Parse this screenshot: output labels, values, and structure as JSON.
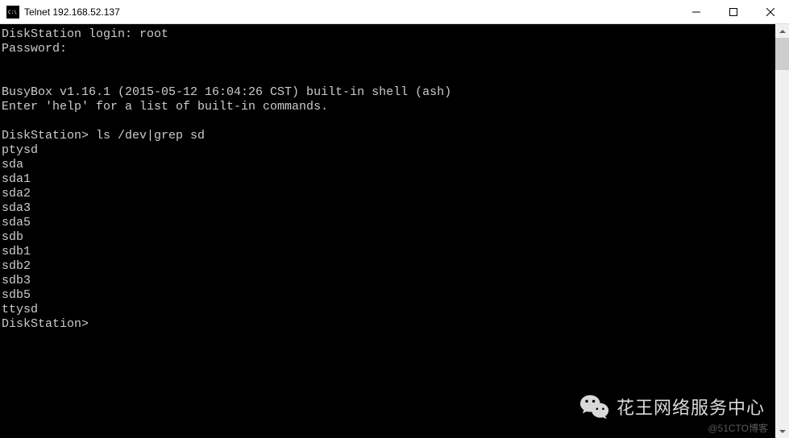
{
  "window": {
    "title": "Telnet 192.168.52.137",
    "icon_label": "cmd"
  },
  "terminal": {
    "lines": [
      "DiskStation login: root",
      "Password:",
      "",
      "",
      "BusyBox v1.16.1 (2015-05-12 16:04:26 CST) built-in shell (ash)",
      "Enter 'help' for a list of built-in commands.",
      "",
      "DiskStation> ls /dev|grep sd",
      "ptysd",
      "sda",
      "sda1",
      "sda2",
      "sda3",
      "sda5",
      "sdb",
      "sdb1",
      "sdb2",
      "sdb3",
      "sdb5",
      "ttysd",
      "DiskStation>"
    ]
  },
  "watermark": {
    "wechat_text": "花王网络服务中心",
    "blog_text": "@51CTO博客"
  }
}
